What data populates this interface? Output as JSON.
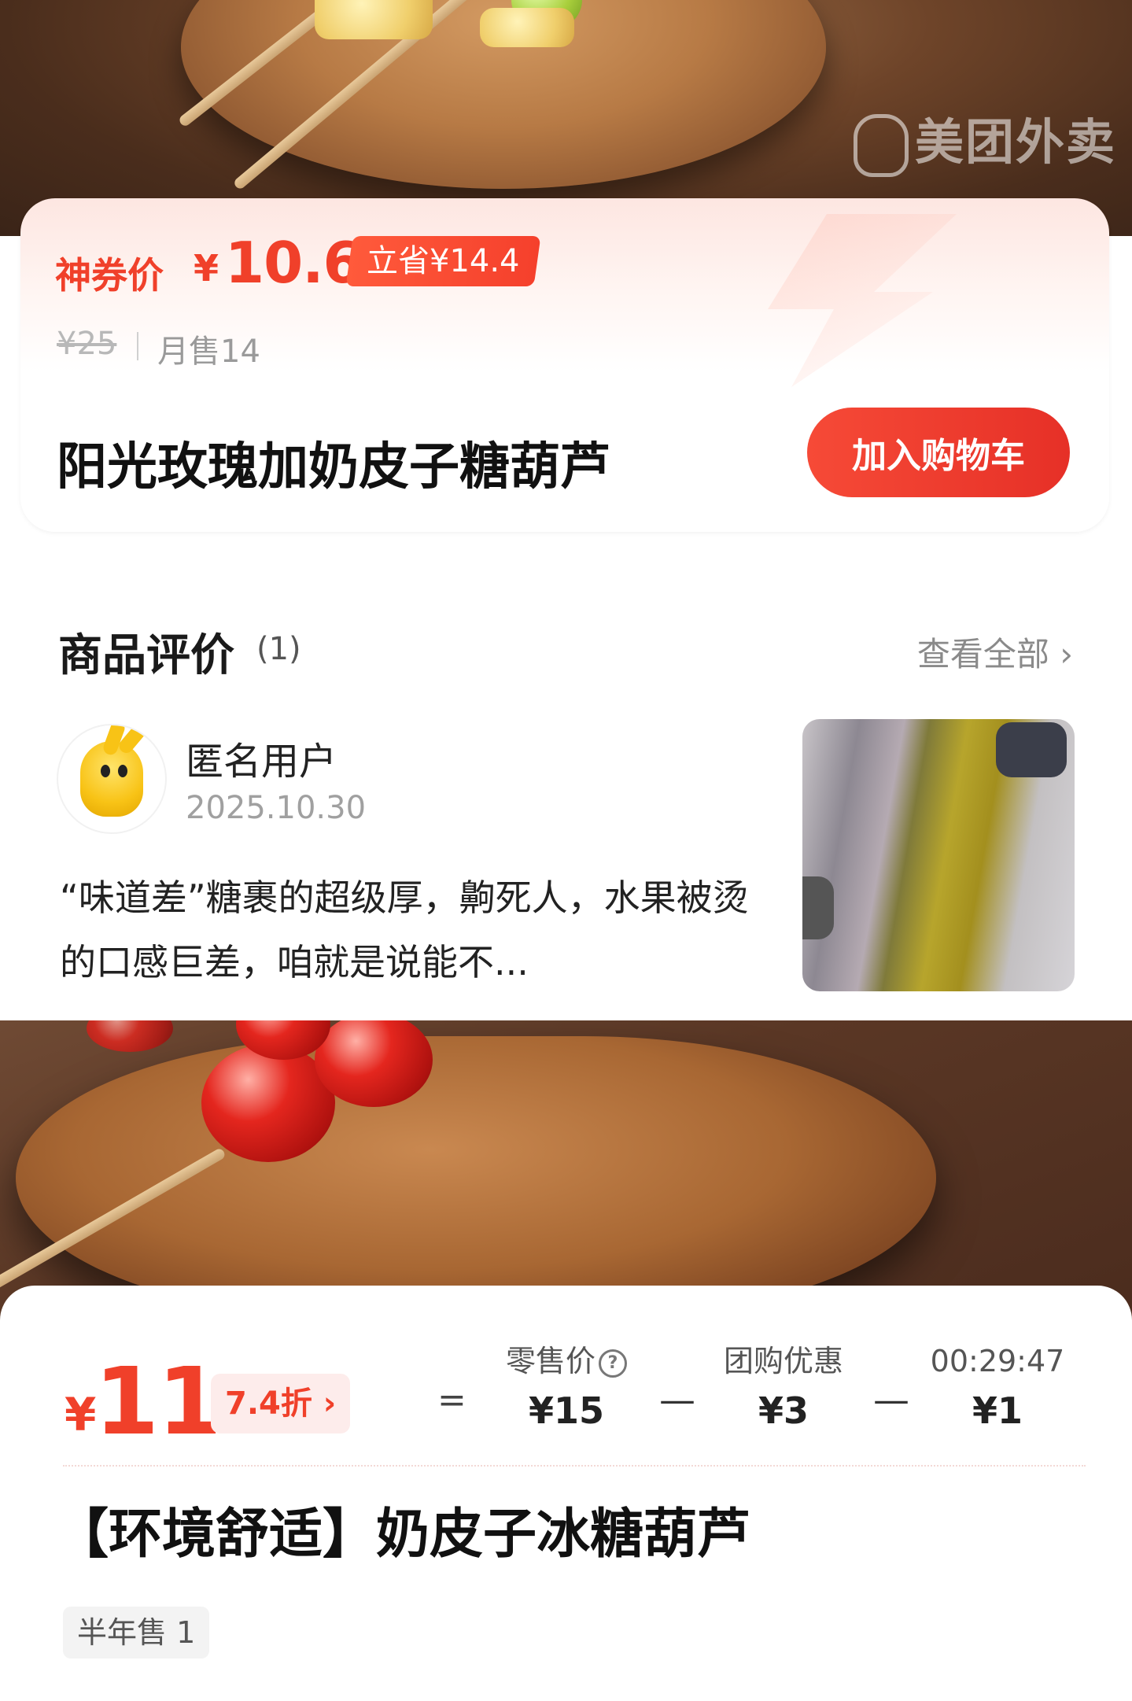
{
  "watermark": "美团外卖",
  "product_card": {
    "coupon_label": "神券价",
    "currency": "¥",
    "coupon_price": "10.6",
    "save_badge": "立省¥14.4",
    "original_price": "¥25",
    "monthly_sales": "月售14",
    "name": "阳光玫瑰加奶皮子糖葫芦",
    "add_to_cart": "加入购物车",
    "accent_color": "#f0402a"
  },
  "reviews": {
    "title": "商品评价",
    "count": "(1)",
    "view_all": "查看全部 ›",
    "items": [
      {
        "user": "匿名用户",
        "date": "2025.10.30",
        "text": "“味道差”糖裹的超级厚，齁死人，水果被烫的口感巨差，咱就是说能不..."
      }
    ]
  },
  "deal_card": {
    "currency": "¥",
    "price": "11",
    "discount": "7.4折 ›",
    "equals": "=",
    "retail_label": "零售价",
    "retail_value": "¥15",
    "group_label": "团购优惠",
    "group_value": "¥3",
    "timer_label": "00:29:47",
    "timer_value": "¥1",
    "minus": "—",
    "name": "【环境舒适】奶皮子冰糖葫芦",
    "half_year_sales": "半年售 1"
  }
}
